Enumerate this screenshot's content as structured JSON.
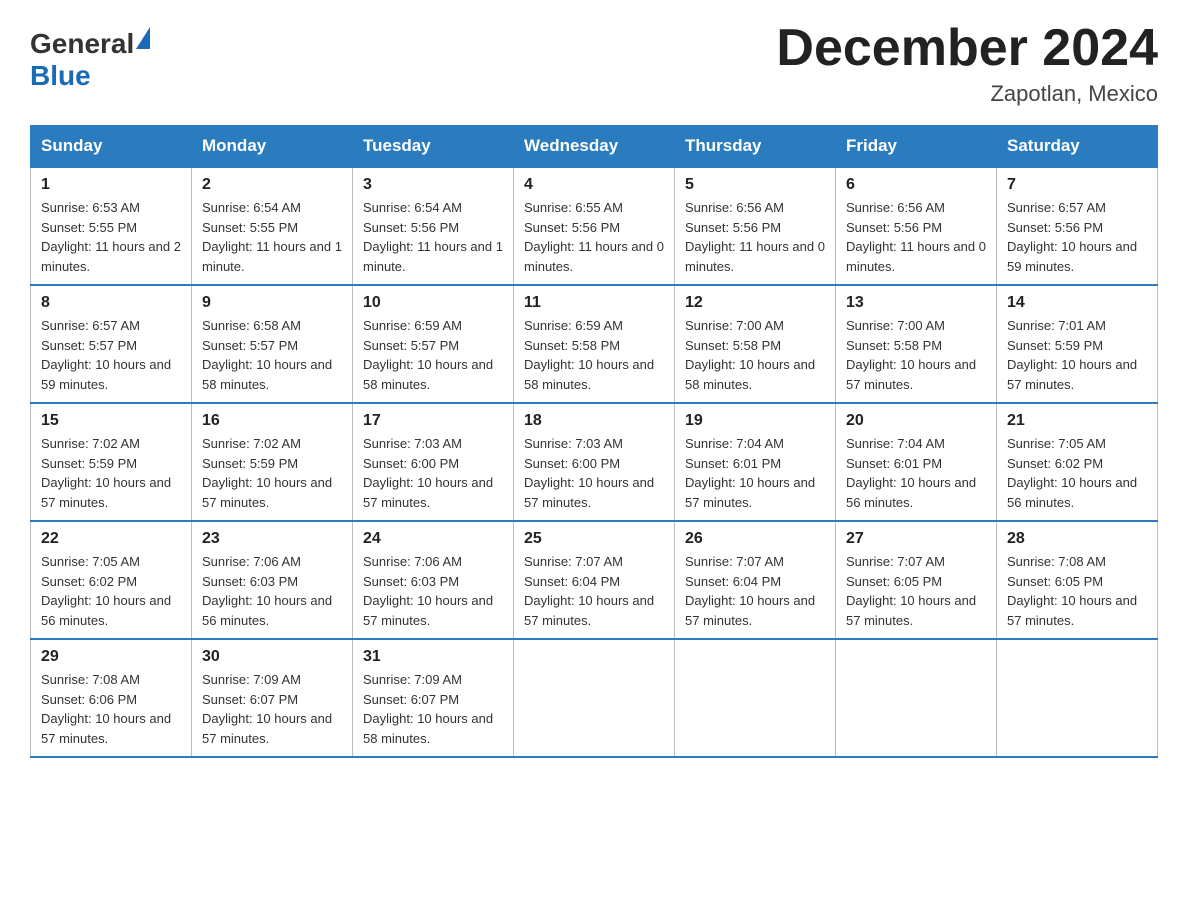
{
  "header": {
    "logo_general": "General",
    "logo_blue": "Blue",
    "title": "December 2024",
    "subtitle": "Zapotlan, Mexico"
  },
  "days_of_week": [
    "Sunday",
    "Monday",
    "Tuesday",
    "Wednesday",
    "Thursday",
    "Friday",
    "Saturday"
  ],
  "weeks": [
    [
      {
        "day": "1",
        "sunrise": "6:53 AM",
        "sunset": "5:55 PM",
        "daylight": "11 hours and 2 minutes."
      },
      {
        "day": "2",
        "sunrise": "6:54 AM",
        "sunset": "5:55 PM",
        "daylight": "11 hours and 1 minute."
      },
      {
        "day": "3",
        "sunrise": "6:54 AM",
        "sunset": "5:56 PM",
        "daylight": "11 hours and 1 minute."
      },
      {
        "day": "4",
        "sunrise": "6:55 AM",
        "sunset": "5:56 PM",
        "daylight": "11 hours and 0 minutes."
      },
      {
        "day": "5",
        "sunrise": "6:56 AM",
        "sunset": "5:56 PM",
        "daylight": "11 hours and 0 minutes."
      },
      {
        "day": "6",
        "sunrise": "6:56 AM",
        "sunset": "5:56 PM",
        "daylight": "11 hours and 0 minutes."
      },
      {
        "day": "7",
        "sunrise": "6:57 AM",
        "sunset": "5:56 PM",
        "daylight": "10 hours and 59 minutes."
      }
    ],
    [
      {
        "day": "8",
        "sunrise": "6:57 AM",
        "sunset": "5:57 PM",
        "daylight": "10 hours and 59 minutes."
      },
      {
        "day": "9",
        "sunrise": "6:58 AM",
        "sunset": "5:57 PM",
        "daylight": "10 hours and 58 minutes."
      },
      {
        "day": "10",
        "sunrise": "6:59 AM",
        "sunset": "5:57 PM",
        "daylight": "10 hours and 58 minutes."
      },
      {
        "day": "11",
        "sunrise": "6:59 AM",
        "sunset": "5:58 PM",
        "daylight": "10 hours and 58 minutes."
      },
      {
        "day": "12",
        "sunrise": "7:00 AM",
        "sunset": "5:58 PM",
        "daylight": "10 hours and 58 minutes."
      },
      {
        "day": "13",
        "sunrise": "7:00 AM",
        "sunset": "5:58 PM",
        "daylight": "10 hours and 57 minutes."
      },
      {
        "day": "14",
        "sunrise": "7:01 AM",
        "sunset": "5:59 PM",
        "daylight": "10 hours and 57 minutes."
      }
    ],
    [
      {
        "day": "15",
        "sunrise": "7:02 AM",
        "sunset": "5:59 PM",
        "daylight": "10 hours and 57 minutes."
      },
      {
        "day": "16",
        "sunrise": "7:02 AM",
        "sunset": "5:59 PM",
        "daylight": "10 hours and 57 minutes."
      },
      {
        "day": "17",
        "sunrise": "7:03 AM",
        "sunset": "6:00 PM",
        "daylight": "10 hours and 57 minutes."
      },
      {
        "day": "18",
        "sunrise": "7:03 AM",
        "sunset": "6:00 PM",
        "daylight": "10 hours and 57 minutes."
      },
      {
        "day": "19",
        "sunrise": "7:04 AM",
        "sunset": "6:01 PM",
        "daylight": "10 hours and 57 minutes."
      },
      {
        "day": "20",
        "sunrise": "7:04 AM",
        "sunset": "6:01 PM",
        "daylight": "10 hours and 56 minutes."
      },
      {
        "day": "21",
        "sunrise": "7:05 AM",
        "sunset": "6:02 PM",
        "daylight": "10 hours and 56 minutes."
      }
    ],
    [
      {
        "day": "22",
        "sunrise": "7:05 AM",
        "sunset": "6:02 PM",
        "daylight": "10 hours and 56 minutes."
      },
      {
        "day": "23",
        "sunrise": "7:06 AM",
        "sunset": "6:03 PM",
        "daylight": "10 hours and 56 minutes."
      },
      {
        "day": "24",
        "sunrise": "7:06 AM",
        "sunset": "6:03 PM",
        "daylight": "10 hours and 57 minutes."
      },
      {
        "day": "25",
        "sunrise": "7:07 AM",
        "sunset": "6:04 PM",
        "daylight": "10 hours and 57 minutes."
      },
      {
        "day": "26",
        "sunrise": "7:07 AM",
        "sunset": "6:04 PM",
        "daylight": "10 hours and 57 minutes."
      },
      {
        "day": "27",
        "sunrise": "7:07 AM",
        "sunset": "6:05 PM",
        "daylight": "10 hours and 57 minutes."
      },
      {
        "day": "28",
        "sunrise": "7:08 AM",
        "sunset": "6:05 PM",
        "daylight": "10 hours and 57 minutes."
      }
    ],
    [
      {
        "day": "29",
        "sunrise": "7:08 AM",
        "sunset": "6:06 PM",
        "daylight": "10 hours and 57 minutes."
      },
      {
        "day": "30",
        "sunrise": "7:09 AM",
        "sunset": "6:07 PM",
        "daylight": "10 hours and 57 minutes."
      },
      {
        "day": "31",
        "sunrise": "7:09 AM",
        "sunset": "6:07 PM",
        "daylight": "10 hours and 58 minutes."
      },
      null,
      null,
      null,
      null
    ]
  ]
}
